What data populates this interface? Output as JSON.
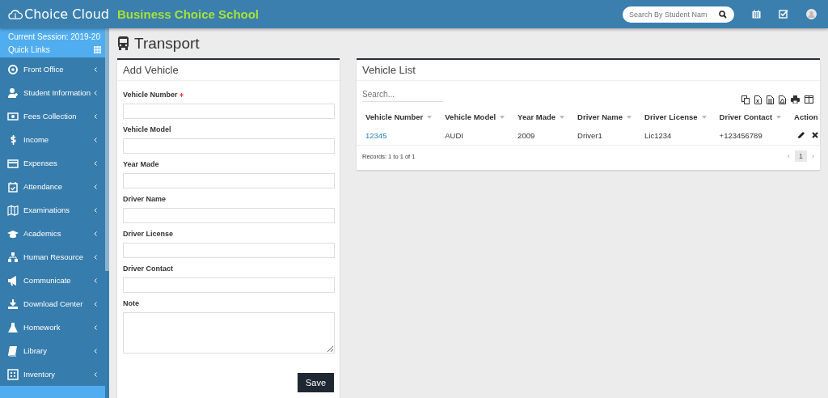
{
  "header": {
    "brand": "Choice Cloud",
    "school": "Business Choice School",
    "search": {
      "placeholder": "Search By Student Nam"
    }
  },
  "sidebar": {
    "session": "Current Session: 2019-20",
    "quick_links": "Quick Links",
    "items": [
      {
        "label": "Front Office"
      },
      {
        "label": "Student Information"
      },
      {
        "label": "Fees Collection"
      },
      {
        "label": "Income"
      },
      {
        "label": "Expenses"
      },
      {
        "label": "Attendance"
      },
      {
        "label": "Examinations"
      },
      {
        "label": "Academics"
      },
      {
        "label": "Human Resource"
      },
      {
        "label": "Communicate"
      },
      {
        "label": "Download Center"
      },
      {
        "label": "Homework"
      },
      {
        "label": "Library"
      },
      {
        "label": "Inventory"
      }
    ]
  },
  "page_title": "Transport",
  "add_vehicle": {
    "title": "Add Vehicle",
    "fields": [
      {
        "label": "Vehicle Number",
        "required": true,
        "kind": "input"
      },
      {
        "label": "Vehicle Model",
        "required": false,
        "kind": "input"
      },
      {
        "label": "Year Made",
        "required": false,
        "kind": "input"
      },
      {
        "label": "Driver Name",
        "required": false,
        "kind": "input"
      },
      {
        "label": "Driver License",
        "required": false,
        "kind": "input"
      },
      {
        "label": "Driver Contact",
        "required": false,
        "kind": "input"
      },
      {
        "label": "Note",
        "required": false,
        "kind": "textarea"
      }
    ],
    "save": "Save"
  },
  "vehicle_list": {
    "title": "Vehicle List",
    "search": {
      "placeholder": "Search..."
    },
    "columns": [
      {
        "label": "Vehicle Number",
        "sortable": true
      },
      {
        "label": "Vehicle Model",
        "sortable": true
      },
      {
        "label": "Year Made",
        "sortable": true
      },
      {
        "label": "Driver Name",
        "sortable": true
      },
      {
        "label": "Driver License",
        "sortable": true
      },
      {
        "label": "Driver Contact",
        "sortable": true
      },
      {
        "label": "Action",
        "sortable": false
      }
    ],
    "rows": [
      {
        "cells": [
          "12345",
          "AUDI",
          "2009",
          "Driver1",
          "Lic1234",
          "+123456789"
        ]
      }
    ],
    "records": "Records: 1 to 1 of 1",
    "pagination": {
      "prev": "‹",
      "next": "›",
      "pages": [
        {
          "label": "1",
          "selected": true
        }
      ]
    }
  }
}
